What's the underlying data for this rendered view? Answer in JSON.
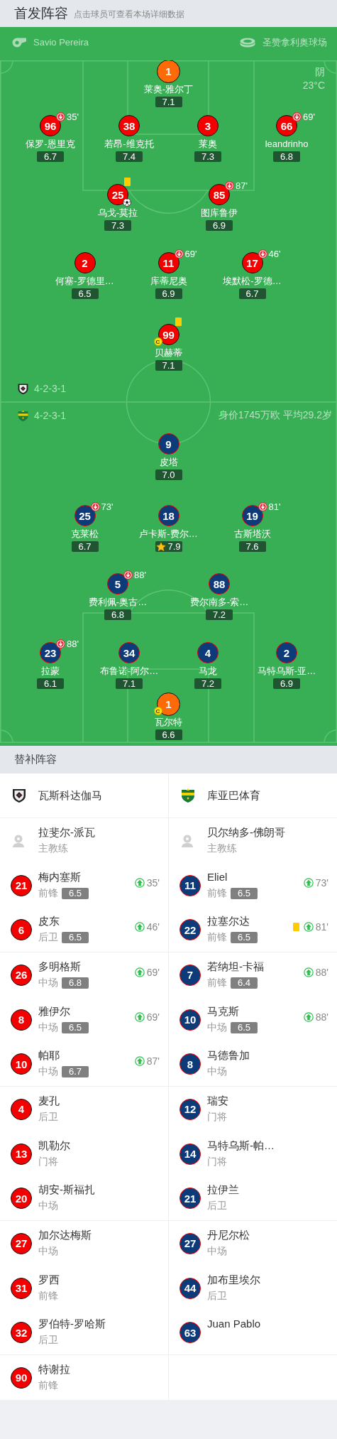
{
  "header": {
    "title": "首发阵容",
    "hint": "点击球员可查看本场详细数据"
  },
  "match_info": {
    "referee": "Savio Pereira",
    "stadium": "圣赞拿利奥球场",
    "weather": "阴",
    "temperature": "23°C"
  },
  "home": {
    "formation": "4-2-3-1",
    "lines": [
      [
        {
          "number": "1",
          "name": "莱奥-雅尔丁",
          "rating": "7.1",
          "kind": "goalkeeper",
          "card": false,
          "goal": false,
          "best": false
        }
      ],
      [
        {
          "number": "96",
          "name": "保罗-恩里克",
          "rating": "6.7",
          "kind": "outfield",
          "sub_off": "35'",
          "card": false,
          "goal": false,
          "best": false
        },
        {
          "number": "38",
          "name": "若昂-维克托",
          "rating": "7.4",
          "kind": "outfield",
          "card": false,
          "goal": false,
          "best": false
        },
        {
          "number": "3",
          "name": "莱奥",
          "rating": "7.3",
          "kind": "outfield",
          "card": false,
          "goal": false,
          "best": false
        },
        {
          "number": "66",
          "name": "leandrinho",
          "rating": "6.8",
          "kind": "outfield",
          "sub_off": "69'",
          "card": false,
          "goal": false,
          "best": false
        }
      ],
      [
        {
          "number": "25",
          "name": "乌戈-莫拉",
          "rating": "7.3",
          "kind": "outfield",
          "card": true,
          "goal": true,
          "best": false
        },
        {
          "number": "85",
          "name": "图库鲁伊",
          "rating": "6.9",
          "kind": "outfield",
          "sub_off": "87'",
          "card": false,
          "goal": false,
          "best": false
        }
      ],
      [
        {
          "number": "2",
          "name": "何塞-罗德里…",
          "rating": "6.5",
          "kind": "outfield",
          "card": false,
          "goal": false,
          "best": false
        },
        {
          "number": "11",
          "name": "库蒂尼奥",
          "rating": "6.9",
          "kind": "outfield",
          "sub_off": "69'",
          "card": false,
          "goal": false,
          "best": false
        },
        {
          "number": "17",
          "name": "埃默松-罗德…",
          "rating": "6.7",
          "kind": "outfield",
          "sub_off": "46'",
          "card": false,
          "goal": false,
          "best": false
        }
      ],
      [
        {
          "number": "99",
          "name": "贝赫蒂",
          "rating": "7.1",
          "kind": "outfield",
          "captain": "C",
          "card": true,
          "goal": false,
          "best": false
        }
      ]
    ]
  },
  "away": {
    "formation": "4-2-3-1",
    "value_info": "身价1745万欧 平均29.2岁",
    "lines": [
      [
        {
          "number": "9",
          "name": "皮塔",
          "rating": "7.0",
          "kind": "outfield",
          "card": false,
          "goal": false,
          "best": false
        }
      ],
      [
        {
          "number": "25",
          "name": "克莱松",
          "rating": "6.7",
          "kind": "outfield",
          "sub_off": "73'",
          "card": false,
          "goal": false,
          "best": false
        },
        {
          "number": "18",
          "name": "卢卡斯-费尔…",
          "rating": "7.9",
          "kind": "outfield",
          "card": false,
          "goal": false,
          "best": true
        },
        {
          "number": "19",
          "name": "古斯塔沃",
          "rating": "7.6",
          "kind": "outfield",
          "sub_off": "81'",
          "card": false,
          "goal": false,
          "best": false
        }
      ],
      [
        {
          "number": "5",
          "name": "费利佩-奥古…",
          "rating": "6.8",
          "kind": "outfield",
          "sub_off": "88'",
          "card": false,
          "goal": false,
          "best": false
        },
        {
          "number": "88",
          "name": "费尔南多-索…",
          "rating": "7.2",
          "kind": "outfield",
          "card": false,
          "goal": false,
          "best": false
        }
      ],
      [
        {
          "number": "23",
          "name": "拉蒙",
          "rating": "6.1",
          "kind": "outfield",
          "sub_off": "88'",
          "card": false,
          "goal": false,
          "best": false
        },
        {
          "number": "34",
          "name": "布鲁诺-阿尔…",
          "rating": "7.1",
          "kind": "outfield",
          "card": false,
          "goal": false,
          "best": false
        },
        {
          "number": "4",
          "name": "马龙",
          "rating": "7.2",
          "kind": "outfield",
          "card": false,
          "goal": false,
          "best": false
        },
        {
          "number": "2",
          "name": "马特乌斯-亚…",
          "rating": "6.9",
          "kind": "outfield",
          "card": false,
          "goal": false,
          "best": false
        }
      ],
      [
        {
          "number": "1",
          "name": "瓦尔特",
          "rating": "6.6",
          "kind": "goalkeeper",
          "captain": "C",
          "card": false,
          "goal": false,
          "best": false
        }
      ]
    ]
  },
  "subs": {
    "title": "替补阵容",
    "teams": [
      {
        "name": "瓦斯科达伽马",
        "coach": "拉斐尔-派瓦",
        "coach_role": "主教练",
        "players": [
          {
            "number": "21",
            "name": "梅内塞斯",
            "position": "前锋",
            "rating": "6.5",
            "sub_in": "35'",
            "card": false
          },
          {
            "number": "6",
            "name": "皮东",
            "position": "后卫",
            "rating": "6.5",
            "sub_in": "46'",
            "card": false
          },
          {
            "number": "26",
            "name": "多明格斯",
            "position": "中场",
            "rating": "6.8",
            "sub_in": "69'",
            "card": false
          },
          {
            "number": "8",
            "name": "雅伊尔",
            "position": "中场",
            "rating": "6.5",
            "sub_in": "69'",
            "card": false
          },
          {
            "number": "10",
            "name": "帕耶",
            "position": "中场",
            "rating": "6.7",
            "sub_in": "87'",
            "card": false
          },
          {
            "number": "4",
            "name": "麦孔",
            "position": "后卫",
            "card": false
          },
          {
            "number": "13",
            "name": "凯勒尔",
            "position": "门将",
            "card": false
          },
          {
            "number": "20",
            "name": "胡安-斯福扎",
            "position": "中场",
            "card": false
          },
          {
            "number": "27",
            "name": "加尔达梅斯",
            "position": "中场",
            "card": false
          },
          {
            "number": "31",
            "name": "罗西",
            "position": "前锋",
            "card": false
          },
          {
            "number": "32",
            "name": "罗伯特-罗哈斯",
            "position": "后卫",
            "card": false
          },
          {
            "number": "90",
            "name": "特谢拉",
            "position": "前锋",
            "card": false
          }
        ]
      },
      {
        "name": "库亚巴体育",
        "coach": "贝尔纳多-佛朗哥",
        "coach_role": "主教练",
        "players": [
          {
            "number": "11",
            "name": "Eliel",
            "position": "前锋",
            "rating": "6.5",
            "sub_in": "73'",
            "card": false
          },
          {
            "number": "22",
            "name": "拉塞尔达",
            "position": "前锋",
            "rating": "6.5",
            "sub_in": "81'",
            "card": true
          },
          {
            "number": "7",
            "name": "若纳坦-卡福",
            "position": "前锋",
            "rating": "6.4",
            "sub_in": "88'",
            "card": false
          },
          {
            "number": "10",
            "name": "马克斯",
            "position": "中场",
            "rating": "6.5",
            "sub_in": "88'",
            "card": false
          },
          {
            "number": "8",
            "name": "马德鲁加",
            "position": "中场",
            "card": false
          },
          {
            "number": "12",
            "name": "瑞安",
            "position": "门将",
            "card": false
          },
          {
            "number": "14",
            "name": "马特乌斯-帕…",
            "position": "门将",
            "card": false
          },
          {
            "number": "21",
            "name": "拉伊兰",
            "position": "后卫",
            "card": false
          },
          {
            "number": "27",
            "name": "丹尼尔松",
            "position": "中场",
            "card": false
          },
          {
            "number": "44",
            "name": "加布里埃尔",
            "position": "后卫",
            "card": false
          },
          {
            "number": "63",
            "name": "Juan Pablo",
            "card": false
          }
        ]
      }
    ]
  }
}
